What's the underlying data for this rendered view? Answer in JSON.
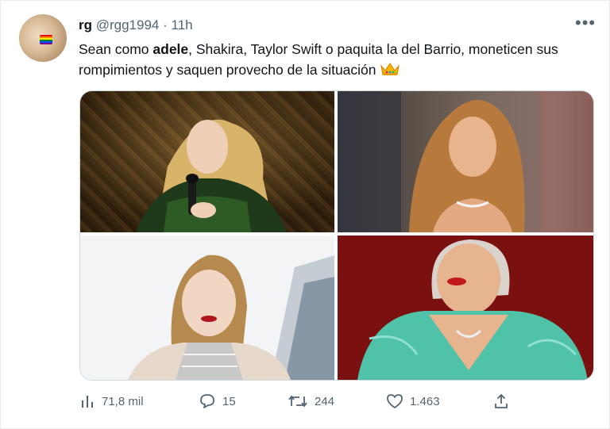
{
  "tweet": {
    "display_name": "rg",
    "handle": "@rgg1994",
    "separator": "·",
    "time": "11h",
    "more_label": "•••",
    "text_parts": {
      "before": "Sean como ",
      "bold": "adele",
      "after": ", Shakira, Taylor Swift o paquita la del Barrio, moneticen sus rompimientos y saquen provecho de la situación"
    },
    "crown_emoji_icon": "crown-icon"
  },
  "media": {
    "images": [
      {
        "slot": "top-left"
      },
      {
        "slot": "top-right"
      },
      {
        "slot": "bottom-left"
      },
      {
        "slot": "bottom-right"
      }
    ]
  },
  "actions": {
    "views": {
      "icon": "analytics-icon",
      "count": "71,8 mil"
    },
    "replies": {
      "icon": "reply-icon",
      "count": "15"
    },
    "retweets": {
      "icon": "retweet-icon",
      "count": "244"
    },
    "likes": {
      "icon": "heart-icon",
      "count": "1.463"
    },
    "share": {
      "icon": "share-icon"
    }
  },
  "colors": {
    "text": "#0f1419",
    "secondary": "#536471",
    "border": "#cfd9de"
  }
}
